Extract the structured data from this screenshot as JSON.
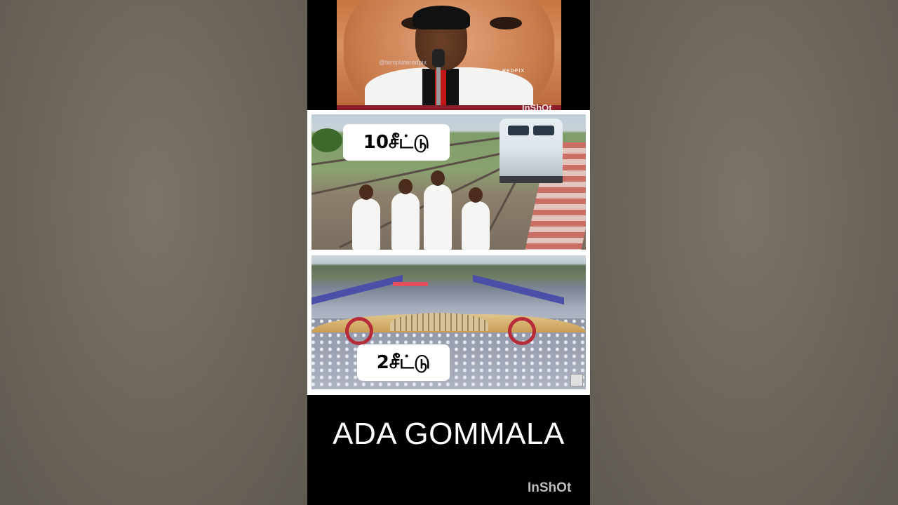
{
  "top_image": {
    "watermark_left": "@templateredpix",
    "watermark_right": "REDPIX",
    "app_watermark": "InShOt"
  },
  "panels": {
    "upper_label": "10சீட்டு",
    "lower_label": "2சீட்டு"
  },
  "caption": "ADA GOMMALA",
  "app_watermark": "InShOt"
}
